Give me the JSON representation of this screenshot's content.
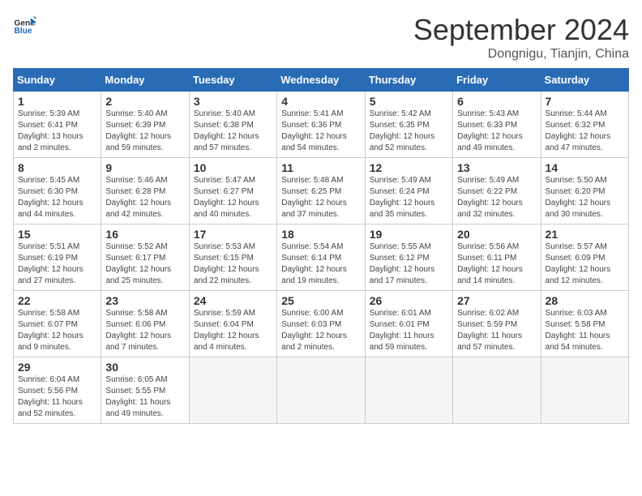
{
  "header": {
    "logo_line1": "General",
    "logo_line2": "Blue",
    "month_title": "September 2024",
    "location": "Dongnigu, Tianjin, China"
  },
  "weekdays": [
    "Sunday",
    "Monday",
    "Tuesday",
    "Wednesday",
    "Thursday",
    "Friday",
    "Saturday"
  ],
  "weeks": [
    [
      {
        "day": "1",
        "info": "Sunrise: 5:39 AM\nSunset: 6:41 PM\nDaylight: 13 hours\nand 2 minutes."
      },
      {
        "day": "2",
        "info": "Sunrise: 5:40 AM\nSunset: 6:39 PM\nDaylight: 12 hours\nand 59 minutes."
      },
      {
        "day": "3",
        "info": "Sunrise: 5:40 AM\nSunset: 6:38 PM\nDaylight: 12 hours\nand 57 minutes."
      },
      {
        "day": "4",
        "info": "Sunrise: 5:41 AM\nSunset: 6:36 PM\nDaylight: 12 hours\nand 54 minutes."
      },
      {
        "day": "5",
        "info": "Sunrise: 5:42 AM\nSunset: 6:35 PM\nDaylight: 12 hours\nand 52 minutes."
      },
      {
        "day": "6",
        "info": "Sunrise: 5:43 AM\nSunset: 6:33 PM\nDaylight: 12 hours\nand 49 minutes."
      },
      {
        "day": "7",
        "info": "Sunrise: 5:44 AM\nSunset: 6:32 PM\nDaylight: 12 hours\nand 47 minutes."
      }
    ],
    [
      {
        "day": "8",
        "info": "Sunrise: 5:45 AM\nSunset: 6:30 PM\nDaylight: 12 hours\nand 44 minutes."
      },
      {
        "day": "9",
        "info": "Sunrise: 5:46 AM\nSunset: 6:28 PM\nDaylight: 12 hours\nand 42 minutes."
      },
      {
        "day": "10",
        "info": "Sunrise: 5:47 AM\nSunset: 6:27 PM\nDaylight: 12 hours\nand 40 minutes."
      },
      {
        "day": "11",
        "info": "Sunrise: 5:48 AM\nSunset: 6:25 PM\nDaylight: 12 hours\nand 37 minutes."
      },
      {
        "day": "12",
        "info": "Sunrise: 5:49 AM\nSunset: 6:24 PM\nDaylight: 12 hours\nand 35 minutes."
      },
      {
        "day": "13",
        "info": "Sunrise: 5:49 AM\nSunset: 6:22 PM\nDaylight: 12 hours\nand 32 minutes."
      },
      {
        "day": "14",
        "info": "Sunrise: 5:50 AM\nSunset: 6:20 PM\nDaylight: 12 hours\nand 30 minutes."
      }
    ],
    [
      {
        "day": "15",
        "info": "Sunrise: 5:51 AM\nSunset: 6:19 PM\nDaylight: 12 hours\nand 27 minutes."
      },
      {
        "day": "16",
        "info": "Sunrise: 5:52 AM\nSunset: 6:17 PM\nDaylight: 12 hours\nand 25 minutes."
      },
      {
        "day": "17",
        "info": "Sunrise: 5:53 AM\nSunset: 6:15 PM\nDaylight: 12 hours\nand 22 minutes."
      },
      {
        "day": "18",
        "info": "Sunrise: 5:54 AM\nSunset: 6:14 PM\nDaylight: 12 hours\nand 19 minutes."
      },
      {
        "day": "19",
        "info": "Sunrise: 5:55 AM\nSunset: 6:12 PM\nDaylight: 12 hours\nand 17 minutes."
      },
      {
        "day": "20",
        "info": "Sunrise: 5:56 AM\nSunset: 6:11 PM\nDaylight: 12 hours\nand 14 minutes."
      },
      {
        "day": "21",
        "info": "Sunrise: 5:57 AM\nSunset: 6:09 PM\nDaylight: 12 hours\nand 12 minutes."
      }
    ],
    [
      {
        "day": "22",
        "info": "Sunrise: 5:58 AM\nSunset: 6:07 PM\nDaylight: 12 hours\nand 9 minutes."
      },
      {
        "day": "23",
        "info": "Sunrise: 5:58 AM\nSunset: 6:06 PM\nDaylight: 12 hours\nand 7 minutes."
      },
      {
        "day": "24",
        "info": "Sunrise: 5:59 AM\nSunset: 6:04 PM\nDaylight: 12 hours\nand 4 minutes."
      },
      {
        "day": "25",
        "info": "Sunrise: 6:00 AM\nSunset: 6:03 PM\nDaylight: 12 hours\nand 2 minutes."
      },
      {
        "day": "26",
        "info": "Sunrise: 6:01 AM\nSunset: 6:01 PM\nDaylight: 11 hours\nand 59 minutes."
      },
      {
        "day": "27",
        "info": "Sunrise: 6:02 AM\nSunset: 5:59 PM\nDaylight: 11 hours\nand 57 minutes."
      },
      {
        "day": "28",
        "info": "Sunrise: 6:03 AM\nSunset: 5:58 PM\nDaylight: 11 hours\nand 54 minutes."
      }
    ],
    [
      {
        "day": "29",
        "info": "Sunrise: 6:04 AM\nSunset: 5:56 PM\nDaylight: 11 hours\nand 52 minutes."
      },
      {
        "day": "30",
        "info": "Sunrise: 6:05 AM\nSunset: 5:55 PM\nDaylight: 11 hours\nand 49 minutes."
      },
      {
        "day": "",
        "info": ""
      },
      {
        "day": "",
        "info": ""
      },
      {
        "day": "",
        "info": ""
      },
      {
        "day": "",
        "info": ""
      },
      {
        "day": "",
        "info": ""
      }
    ]
  ]
}
